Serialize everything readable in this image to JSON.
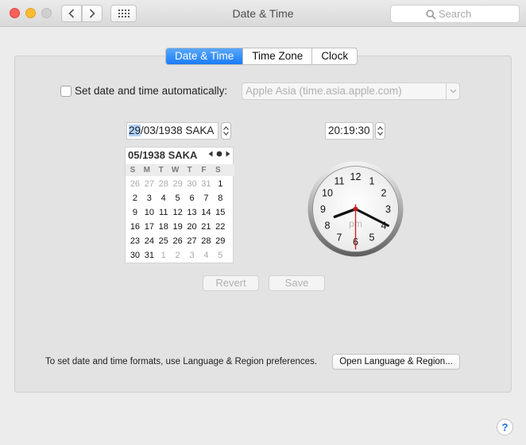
{
  "window": {
    "title": "Date & Time",
    "search_placeholder": "Search"
  },
  "tabs": [
    {
      "label": "Date & Time",
      "active": true
    },
    {
      "label": "Time Zone",
      "active": false
    },
    {
      "label": "Clock",
      "active": false
    }
  ],
  "auto": {
    "label": "Set date and time automatically:",
    "checked": false,
    "server": "Apple Asia (time.asia.apple.com)"
  },
  "date": {
    "day": "29",
    "rest": "/03/1938 SAKA"
  },
  "time": "20:19:30",
  "calendar": {
    "title": "05/1938 SAKA",
    "dow": [
      "S",
      "M",
      "T",
      "W",
      "T",
      "F",
      "S"
    ],
    "weeks": [
      [
        "26",
        "27",
        "28",
        "29",
        "30",
        "31",
        "1"
      ],
      [
        "2",
        "3",
        "4",
        "5",
        "6",
        "7",
        "8"
      ],
      [
        "9",
        "10",
        "11",
        "12",
        "13",
        "14",
        "15"
      ],
      [
        "16",
        "17",
        "18",
        "19",
        "20",
        "21",
        "22"
      ],
      [
        "23",
        "24",
        "25",
        "26",
        "27",
        "28",
        "29"
      ],
      [
        "30",
        "31",
        "1",
        "2",
        "3",
        "4",
        "5"
      ]
    ]
  },
  "clock": {
    "numbers": [
      "12",
      "1",
      "2",
      "3",
      "4",
      "5",
      "6",
      "7",
      "8",
      "9",
      "10",
      "11"
    ],
    "meridiem": "pm",
    "hour": 8,
    "minute": 19,
    "second": 30
  },
  "buttons": {
    "revert": "Revert",
    "save": "Save",
    "open_region": "Open Language & Region...",
    "help": "?"
  },
  "formats_note": "To set date and time formats, use Language & Region preferences."
}
